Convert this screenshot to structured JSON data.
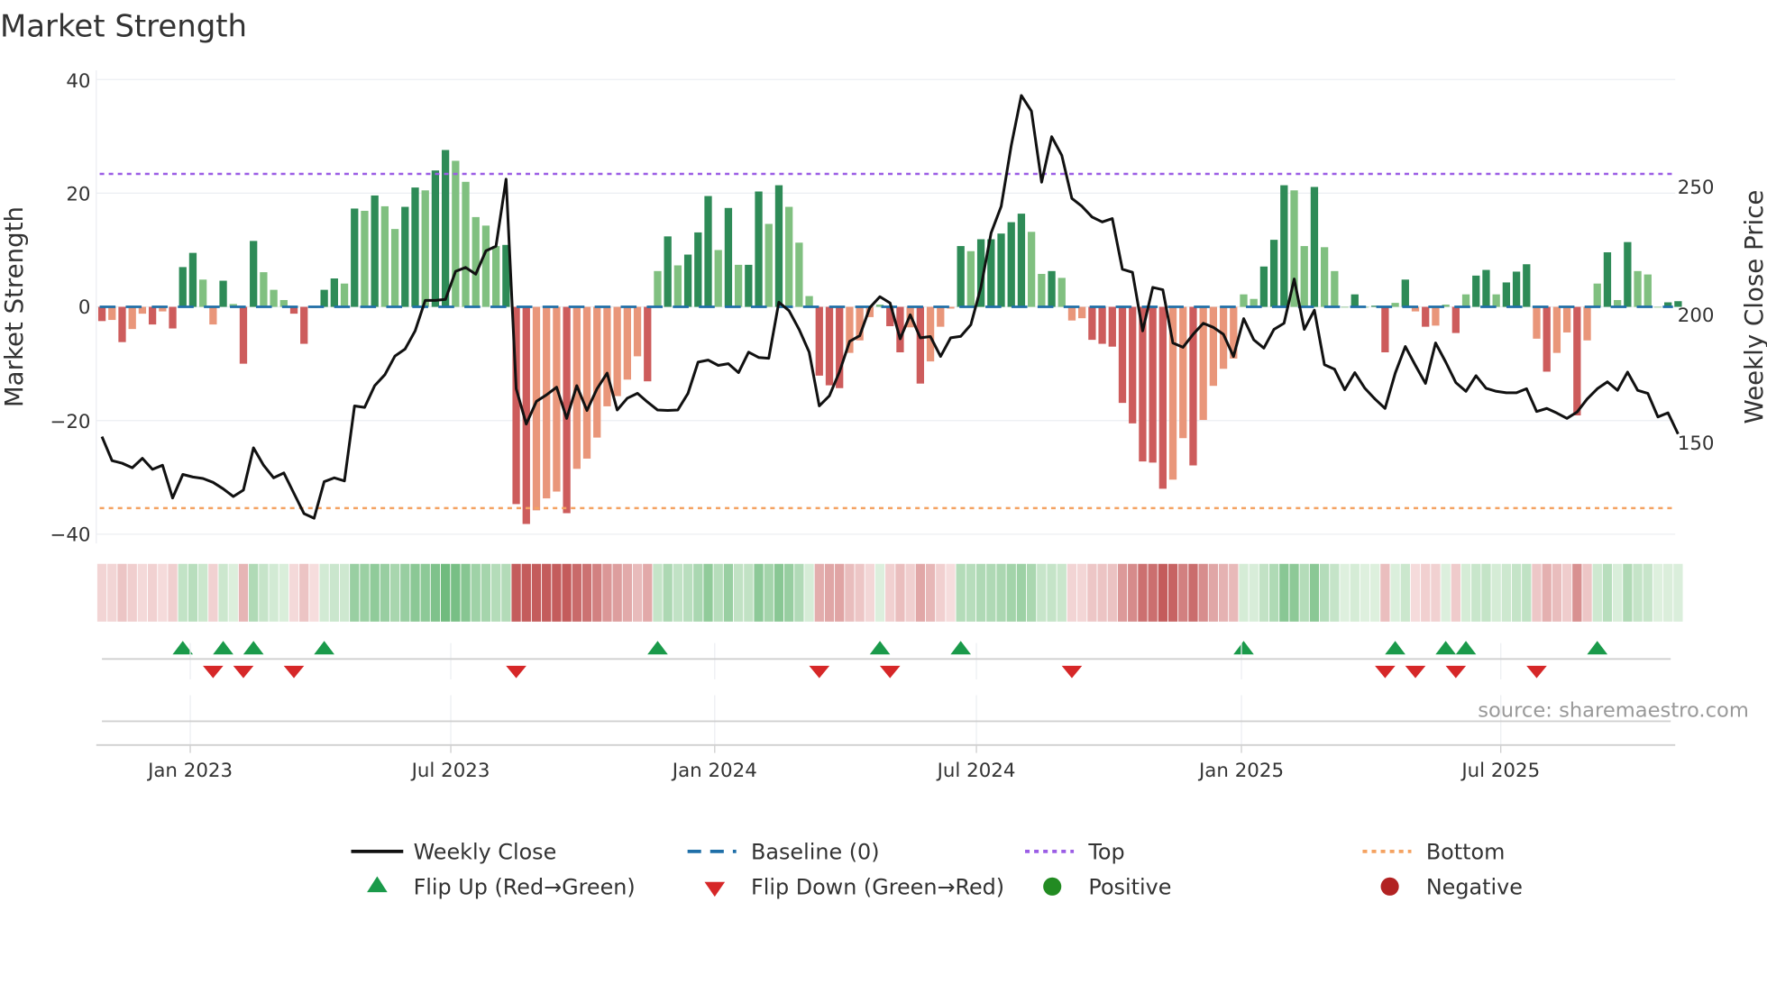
{
  "title": "Market Strength",
  "source": "source: sharemaestro.com",
  "colors": {
    "pos_dark": "#2e8b57",
    "pos_light": "#80c080",
    "neg_dark": "#cd5c5c",
    "neg_light": "#e9967a",
    "baseline": "#1f6fa8",
    "top": "#9b5de5",
    "bottom": "#f4a261",
    "close": "#111111",
    "flip_up": "#1a9a4a",
    "flip_down": "#d62728",
    "positive": "#228b22",
    "negative": "#b22222"
  },
  "legend": {
    "weekly_close": "Weekly Close",
    "baseline": "Baseline (0)",
    "top": "Top",
    "bottom": "Bottom",
    "flip_up": "Flip Up (Red→Green)",
    "flip_down": "Flip Down (Green→Red)",
    "positive": "Positive",
    "negative": "Negative"
  },
  "chart_data": {
    "type": "bar",
    "title": "Market Strength",
    "ylabel": "Market Strength",
    "y2label": "Weekly Close Price",
    "ylim": [
      -41,
      41
    ],
    "y2lim": [
      115,
      296
    ],
    "yticks": [
      "40",
      "20",
      "0",
      "−20",
      "−40"
    ],
    "ytick_values": [
      40,
      20,
      0,
      -20,
      -40
    ],
    "y2ticks": [
      "250",
      "200",
      "150"
    ],
    "y2tick_values": [
      250,
      200,
      150
    ],
    "xticks": [
      "Jan 2023",
      "Jul 2023",
      "Jan 2024",
      "Jul 2024",
      "Jan 2025",
      "Jul 2025"
    ],
    "xtick_week_index": [
      8.74,
      34.53,
      60.65,
      86.55,
      112.78,
      138.45
    ],
    "top_level": 23.4,
    "bottom_level": -35.4,
    "baseline_level": 0,
    "strength": [
      -2.5,
      -2.3,
      -6.2,
      -3.9,
      -1.2,
      -3.1,
      -0.8,
      -3.8,
      7.0,
      9.5,
      4.8,
      -3.1,
      4.6,
      0.5,
      -10,
      11.6,
      6.1,
      3.0,
      1.2,
      -1.2,
      -6.5,
      -0.2,
      3.0,
      5.0,
      4.1,
      17.3,
      16.9,
      19.6,
      17.7,
      13.7,
      17.6,
      21.0,
      20.5,
      24,
      27.6,
      25.7,
      22,
      15.8,
      14.3,
      10.7,
      10.9,
      -34.7,
      -38.2,
      -35.8,
      -33.7,
      -32.5,
      -36.3,
      -28.5,
      -26.7,
      -23,
      -17.5,
      -15.7,
      -12.8,
      -8.7,
      -13.1,
      6.3,
      12.4,
      7.3,
      9.2,
      13.1,
      19.5,
      10,
      17.4,
      7.4,
      7.4,
      20.3,
      14.6,
      21.4,
      17.6,
      11.3,
      1.9,
      -12.1,
      -13.8,
      -14.3,
      -8.1,
      -5.9,
      -1.8,
      0.4,
      -3.4,
      -8,
      -3.6,
      -13.5,
      -9.6,
      -3.5,
      -0.3,
      10.7,
      9.8,
      11.9,
      11.9,
      12.9,
      14.9,
      16.4,
      13.2,
      5.8,
      6.3,
      5.1,
      -2.4,
      -2,
      -5.8,
      -6.5,
      -7,
      -16.9,
      -20.5,
      -27.2,
      -27.4,
      -32,
      -30.4,
      -23.1,
      -27.9,
      -19.9,
      -13.9,
      -10.9,
      -9.1,
      2.2,
      1.4,
      7.1,
      11.8,
      21.4,
      20.5,
      10.7,
      21.1,
      10.5,
      6.3,
      0,
      2.2,
      0,
      0.2,
      -8,
      0.7,
      4.8,
      -0.8,
      -3.5,
      -3.3,
      0.4,
      -4.6,
      2.2,
      5.5,
      6.5,
      2.2,
      4.3,
      6.2,
      7.5,
      -5.6,
      -11.4,
      -8.1,
      -4.5,
      -19.1,
      -5.9,
      4.1,
      9.6,
      1.2,
      11.4,
      6.3,
      5.7,
      0,
      0.8,
      1.0
    ],
    "weekly_close": [
      152.4,
      143,
      142,
      140.2,
      143.9,
      139.6,
      141.2,
      128.4,
      137.6,
      136.6,
      136,
      134.5,
      132,
      129,
      131.5,
      148,
      141.2,
      136.3,
      138.2,
      130.2,
      122.3,
      120.5,
      134.8,
      136.3,
      135.1,
      164.4,
      163.8,
      172.3,
      176.6,
      183.9,
      186.6,
      193.7,
      205.6,
      205.6,
      206,
      217,
      218.5,
      215.9,
      225,
      226.8,
      253,
      171.1,
      157.3,
      166.2,
      168.7,
      171.7,
      159.5,
      172.3,
      162.6,
      171.1,
      177.2,
      162.8,
      167.4,
      169.3,
      165.9,
      162.8,
      162.6,
      162.8,
      169.3,
      181.5,
      182.3,
      180.2,
      180.9,
      177.4,
      185.4,
      183.3,
      183,
      204.9,
      201.6,
      194.3,
      185.4,
      164.4,
      168.3,
      177.8,
      189.6,
      191.8,
      202.8,
      207.1,
      204.6,
      190.6,
      200,
      191,
      191.5,
      183.7,
      191,
      191.6,
      196.1,
      210.7,
      232,
      242.4,
      266.2,
      285.7,
      279.6,
      251.8,
      269.6,
      262.3,
      245.5,
      242.4,
      238.2,
      236.3,
      237.6,
      217.8,
      216.6,
      193.7,
      210.7,
      209.8,
      189,
      187.3,
      192.4,
      196.7,
      195.1,
      192.4,
      183.7,
      198.5,
      190.2,
      187,
      194.3,
      196.7,
      214,
      194.3,
      201.8,
      180.5,
      178.7,
      170.7,
      177.4,
      171.3,
      167.1,
      163.4,
      177.2,
      187.6,
      180.2,
      173.2,
      189,
      181.5,
      173.5,
      170.1,
      176.2,
      171.3,
      170.1,
      169.5,
      169.5,
      171.1,
      162.2,
      163.4,
      161.6,
      159.5,
      162,
      167.1,
      171.1,
      173.8,
      170.5,
      177.6,
      170.5,
      169.3,
      160.1,
      161.7,
      153.4
    ],
    "flip_up_week_index": [
      8,
      12,
      15,
      22,
      55,
      77,
      85,
      113,
      128,
      133,
      135,
      148
    ],
    "flip_down_week_index": [
      11,
      14,
      19,
      41,
      71,
      78,
      96,
      127,
      130,
      134,
      142
    ]
  }
}
